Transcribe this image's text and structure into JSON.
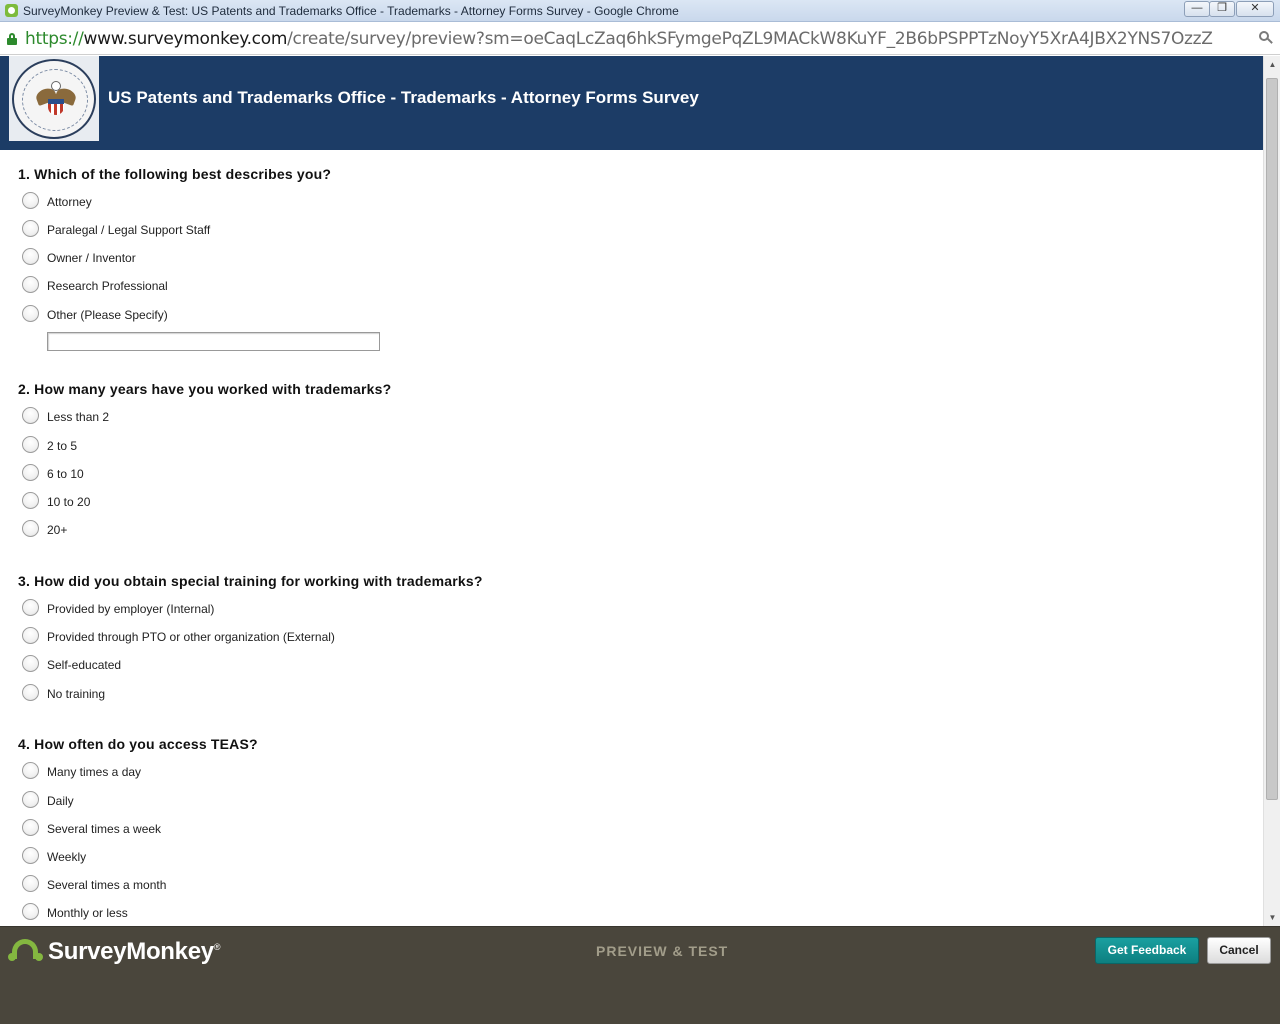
{
  "window": {
    "title": "SurveyMonkey Preview & Test: US Patents and Trademarks Office - Trademarks - Attorney Forms Survey - Google Chrome",
    "minimize_label": "—",
    "maximize_label": "❐",
    "close_label": "✕"
  },
  "urlbar": {
    "scheme": "https://",
    "host": "www.surveymonkey.com",
    "path": "/create/survey/preview?sm=oeCaqLcZaq6hkSFymgePqZL9MACkW8KuYF_2B6bPSPPTzNoyY5XrA4JBX2YNS7OzzZ"
  },
  "survey": {
    "title": "US Patents and Trademarks Office - Trademarks - Attorney Forms Survey",
    "questions": [
      {
        "title": "1. Which of the following best describes you?",
        "options": [
          "Attorney",
          "Paralegal / Legal Support Staff",
          "Owner / Inventor",
          "Research Professional",
          "Other (Please Specify)"
        ],
        "other_value": ""
      },
      {
        "title": "2. How many years have you worked with trademarks?",
        "options": [
          "Less than 2",
          "2 to 5",
          "6 to 10",
          "10 to 20",
          "20+"
        ]
      },
      {
        "title": "3. How did you obtain special training for working with trademarks?",
        "options": [
          "Provided by employer (Internal)",
          "Provided through PTO or other organization (External)",
          "Self-educated",
          "No training"
        ]
      },
      {
        "title": "4. How often do you access TEAS?",
        "options": [
          "Many times a day",
          "Daily",
          "Several times a week",
          "Weekly",
          "Several times a month",
          "Monthly or less"
        ]
      }
    ]
  },
  "scrollbar": {
    "up_arrow": "▲",
    "down_arrow": "▼"
  },
  "footer": {
    "logo_text": "SurveyMonkey",
    "logo_reg": "®",
    "mode_label": "PREVIEW & TEST",
    "feedback_button": "Get Feedback",
    "cancel_button": "Cancel"
  }
}
